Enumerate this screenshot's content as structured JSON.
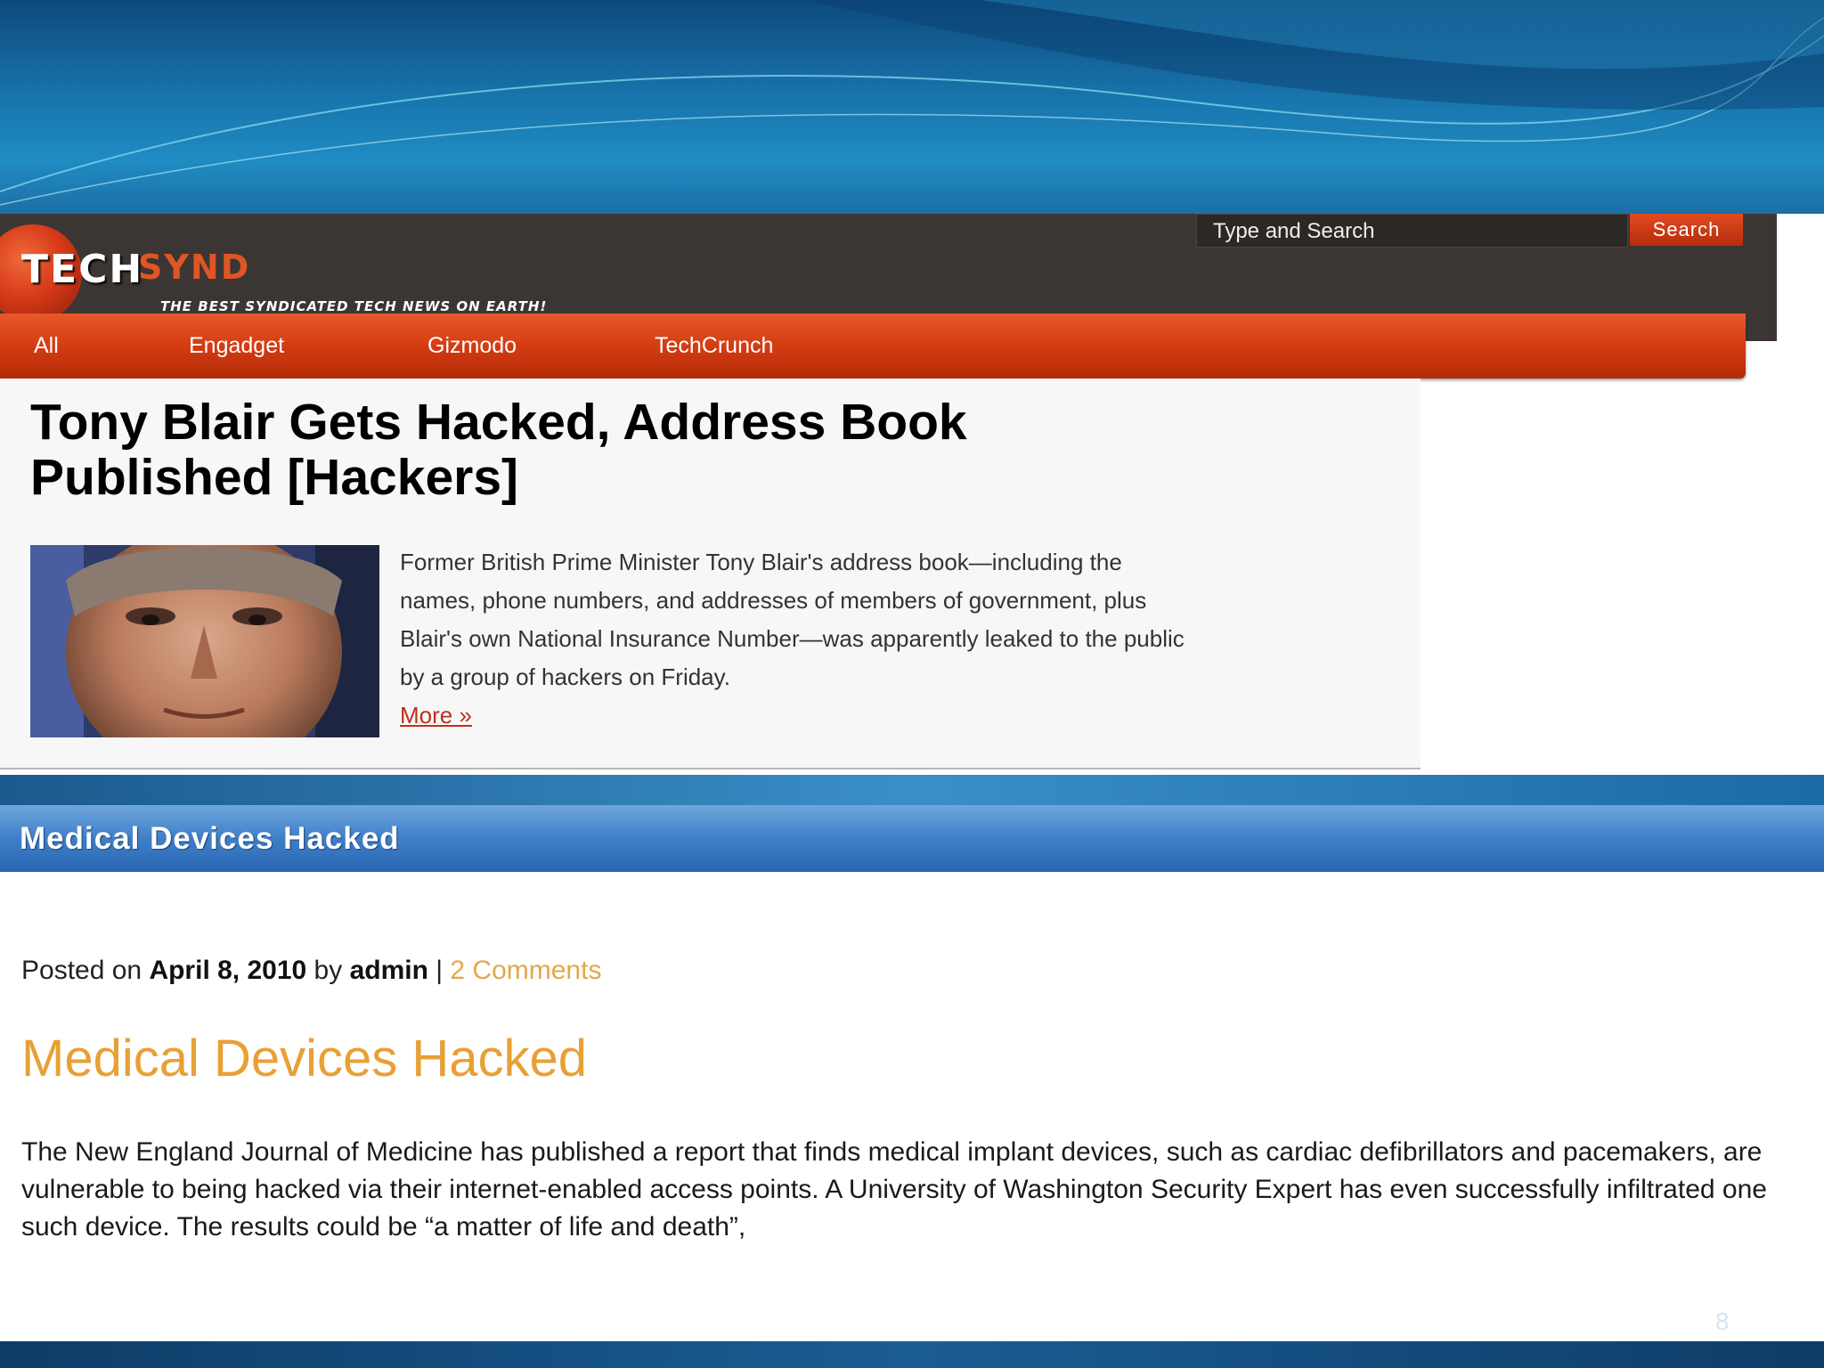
{
  "techsynd": {
    "logo_tech": "TECH",
    "logo_synd": "SYND",
    "tagline": "THE BEST SYNDICATED TECH NEWS ON EARTH!",
    "search_placeholder": "Type and Search",
    "search_button": "Search",
    "nav": [
      "All",
      "Engadget",
      "Gizmodo",
      "TechCrunch"
    ],
    "article_title": "Tony Blair Gets Hacked, Address Book Published [Hackers]",
    "article_body": "Former British Prime Minister Tony Blair's address book—including the names, phone numbers, and addresses of members of government, plus Blair's own National Insurance Number—was apparently leaked to the public by a group of hackers on Friday.",
    "more_link": "More »",
    "accent_color": "#d43c12"
  },
  "medical": {
    "header_title": "Medical Devices Hacked",
    "posted_prefix": "Posted on ",
    "posted_date": "April 8, 2010",
    "posted_by": " by ",
    "author": "admin",
    "separator": " | ",
    "comments": "2 Comments",
    "title": "Medical Devices Hacked",
    "body": "The New England Journal of Medicine has published a report that finds medical implant devices, such as cardiac defibrillators and pacemakers, are vulnerable to being hacked via their internet-enabled access points. A University of Washington Security Expert has even successfully infiltrated one such device. The results could be “a matter of life and death”,",
    "title_color": "#e8a035"
  },
  "slide": {
    "page_number": "8"
  }
}
